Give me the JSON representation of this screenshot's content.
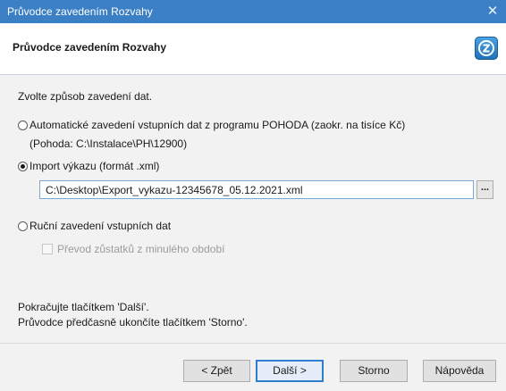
{
  "window": {
    "title": "Průvodce zavedením Rozvahy",
    "close_glyph": "✕"
  },
  "header": {
    "title": "Průvodce zavedením Rozvahy",
    "logo_icon": "pohoda-logo-icon"
  },
  "main": {
    "prompt": "Zvolte způsob zavedení dat.",
    "options": [
      {
        "label": "Automatické zavedení vstupních dat z programu POHODA (zaokr. na tisíce Kč)",
        "detail": "(Pohoda: C:\\Instalace\\PH\\12900)",
        "checked": false
      },
      {
        "label": "Import výkazu (formát .xml)",
        "checked": true,
        "path_value": "C:\\Desktop\\Export_vykazu-12345678_05.12.2021.xml",
        "browse_label": "..."
      },
      {
        "label": "Ruční zavedení vstupních dat",
        "checked": false,
        "checkbox_label": "Převod zůstatků z minulého období",
        "checkbox_checked": false,
        "checkbox_enabled": false
      }
    ],
    "hint_line1": "Pokračujte tlačítkem 'Další'.",
    "hint_line2": "Průvodce předčasně ukončíte tlačítkem 'Storno'."
  },
  "footer": {
    "back_label": "< Zpět",
    "next_label": "Další >",
    "cancel_label": "Storno",
    "help_label": "Nápověda"
  },
  "colors": {
    "titlebar": "#3b7fc4",
    "accent": "#2f7fd0"
  }
}
